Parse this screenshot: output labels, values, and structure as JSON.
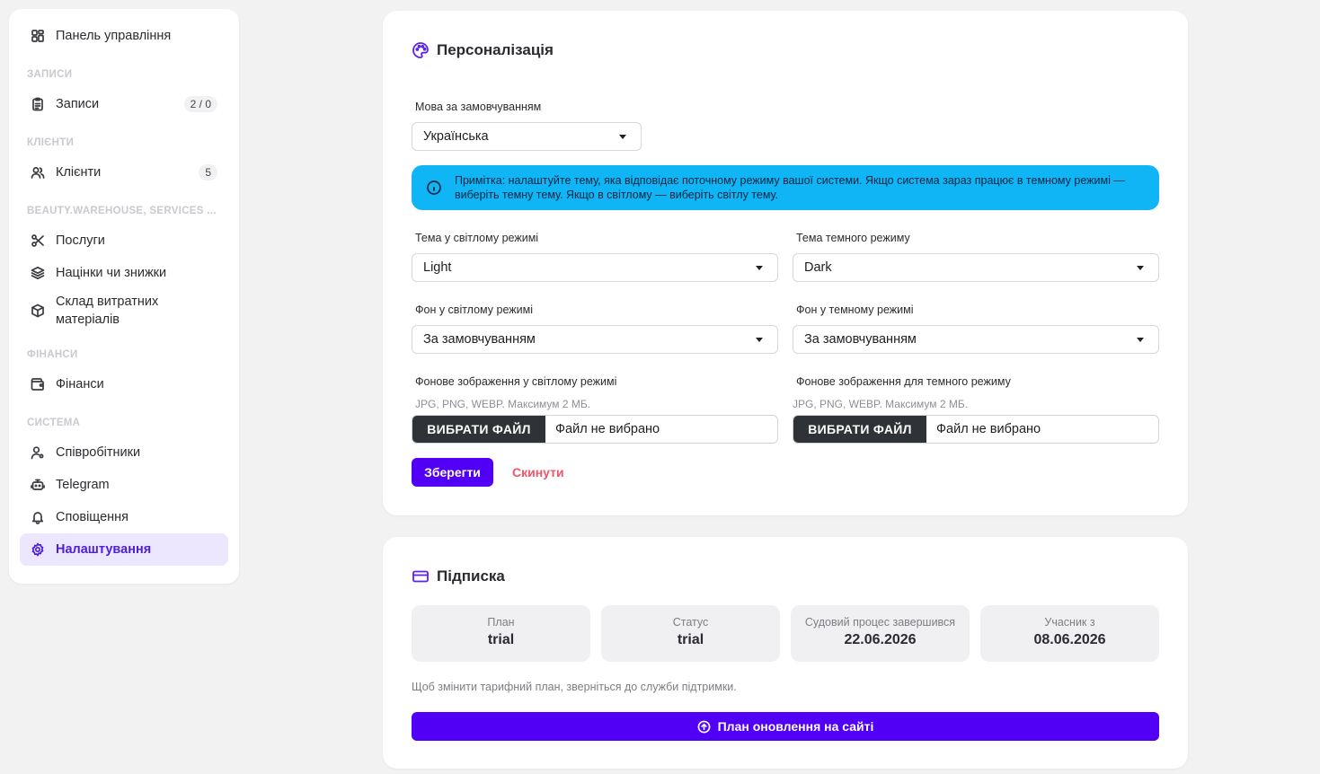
{
  "sidebar": {
    "dashboard": "Панель управління",
    "section_records": "ЗАПИСИ",
    "records": "Записи",
    "records_badge": "2 / 0",
    "section_clients": "КЛІЄНТИ",
    "clients": "Клієнти",
    "clients_badge": "5",
    "section_warehouse": "BEAUTY.WAREHOUSE, SERVICES ...",
    "services": "Послуги",
    "markups": "Націнки чи знижки",
    "warehouse": "Склад витратних матеріалів",
    "section_finance": "ФІНАНСИ",
    "finance": "Фінанси",
    "section_system": "СИСТЕМА",
    "employees": "Співробітники",
    "telegram": "Telegram",
    "notifications": "Сповіщення",
    "settings": "Налаштування"
  },
  "personalization": {
    "title": "Персоналізація",
    "language_label": "Мова за замовчуванням",
    "language_value": "Українська",
    "note": "Примітка: налаштуйте тему, яка відповідає поточному режиму вашої системи. Якщо система зараз працює в темному режимі — виберіть темну тему. Якщо в світлому — виберіть світлу тему.",
    "light_theme_label": "Тема у світлому режимі",
    "light_theme_value": "Light",
    "dark_theme_label": "Тема темного режиму",
    "dark_theme_value": "Dark",
    "light_bg_label": "Фон у світлому режимі",
    "light_bg_value": "За замовчуванням",
    "dark_bg_label": "Фон у темному режимі",
    "dark_bg_value": "За замовчуванням",
    "light_img_label": "Фонове зображення у світлому режимі",
    "dark_img_label": "Фонове зображення для темного режиму",
    "file_hint": "JPG, PNG, WEBP. Максимум 2 МБ.",
    "file_button": "ВИБРАТИ ФАЙЛ",
    "file_none": "Файл не вибрано",
    "save": "Зберегти",
    "reset": "Скинути"
  },
  "subscription": {
    "title": "Підписка",
    "plan_label": "План",
    "plan_value": "trial",
    "status_label": "Статус",
    "status_value": "trial",
    "trial_end_label": "Судовий процес завершився",
    "trial_end_value": "22.06.2026",
    "member_since_label": "Учасник з",
    "member_since_value": "08.06.2026",
    "note": "Щоб змінити тарифний план, зверніться до служби підтримки.",
    "upgrade": "План оновлення на сайті"
  },
  "colors": {
    "accent": "#5200f5",
    "info_bg": "#0fb5f5",
    "reset": "#f0566a",
    "active_nav_bg": "#ece6ff"
  }
}
